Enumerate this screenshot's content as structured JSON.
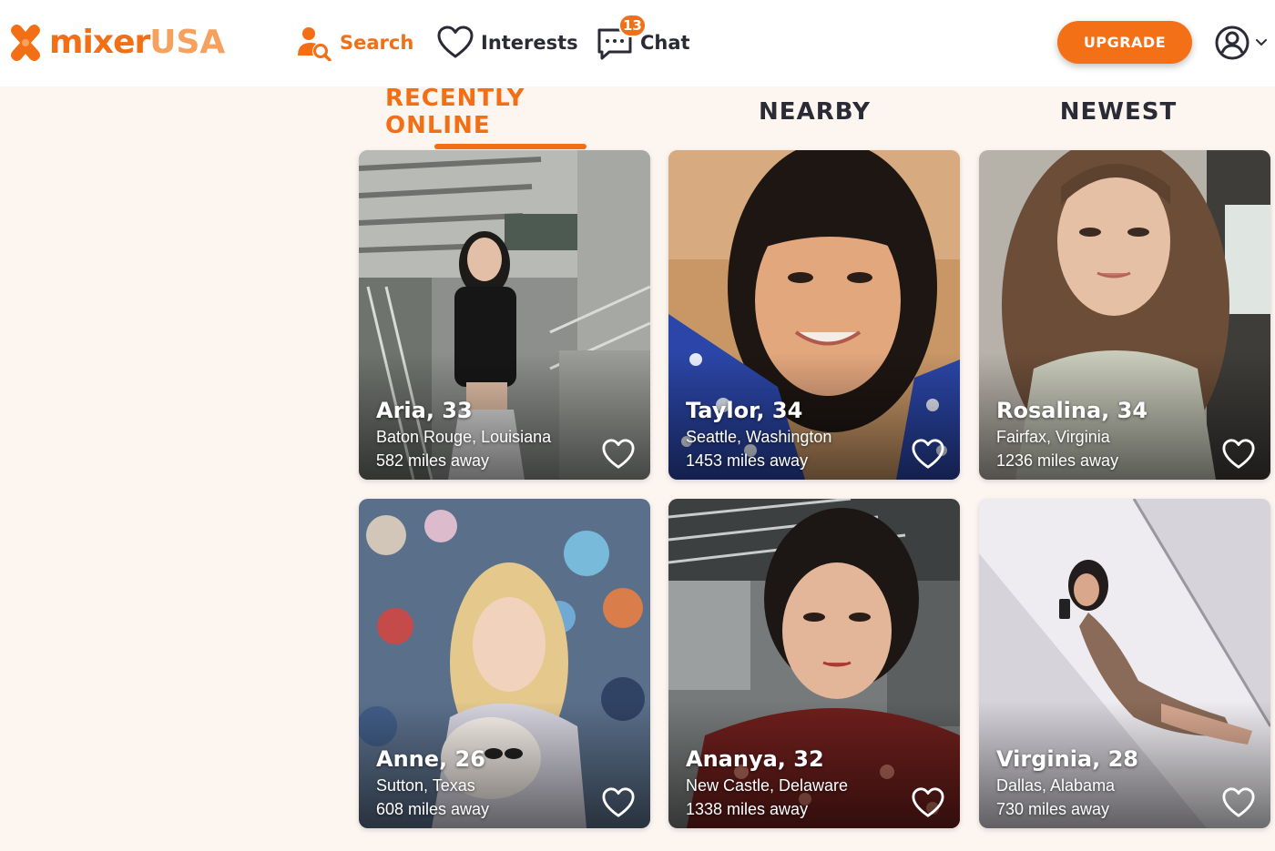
{
  "brand": {
    "name_main": "mixer",
    "name_suffix": "USA"
  },
  "nav": {
    "search_label": "Search",
    "interests_label": "Interests",
    "chat_label": "Chat",
    "chat_badge": "13"
  },
  "upgrade_label": "UPGRADE",
  "tabs": [
    {
      "label": "RECENTLY ONLINE",
      "active": true
    },
    {
      "label": "NEARBY",
      "active": false
    },
    {
      "label": "NEWEST",
      "active": false
    }
  ],
  "profiles": [
    {
      "name": "Aria, 33",
      "location": "Baton Rouge, Louisiana",
      "distance": "582 miles away"
    },
    {
      "name": "Taylor, 34",
      "location": "Seattle, Washington",
      "distance": "1453 miles away"
    },
    {
      "name": "Rosalina, 34",
      "location": "Fairfax, Virginia",
      "distance": "1236 miles away"
    },
    {
      "name": "Anne, 26",
      "location": "Sutton, Texas",
      "distance": "608 miles away"
    },
    {
      "name": "Ananya, 32",
      "location": "New Castle, Delaware",
      "distance": "1338 miles away"
    },
    {
      "name": "Virginia, 28",
      "location": "Dallas, Alabama",
      "distance": "730 miles away"
    }
  ],
  "icons": {
    "logo": "x-mark-logo",
    "search": "user-search-icon",
    "interests": "heart-outline-icon",
    "chat": "chat-bubble-icon",
    "account": "user-circle-icon",
    "dropdown": "chevron-down-icon",
    "card_like": "heart-outline-icon"
  },
  "colors": {
    "accent": "#f36f16",
    "accent_light": "#f7a15e",
    "text_dark": "#2b2b35",
    "page_bg": "#fdf5f0"
  }
}
